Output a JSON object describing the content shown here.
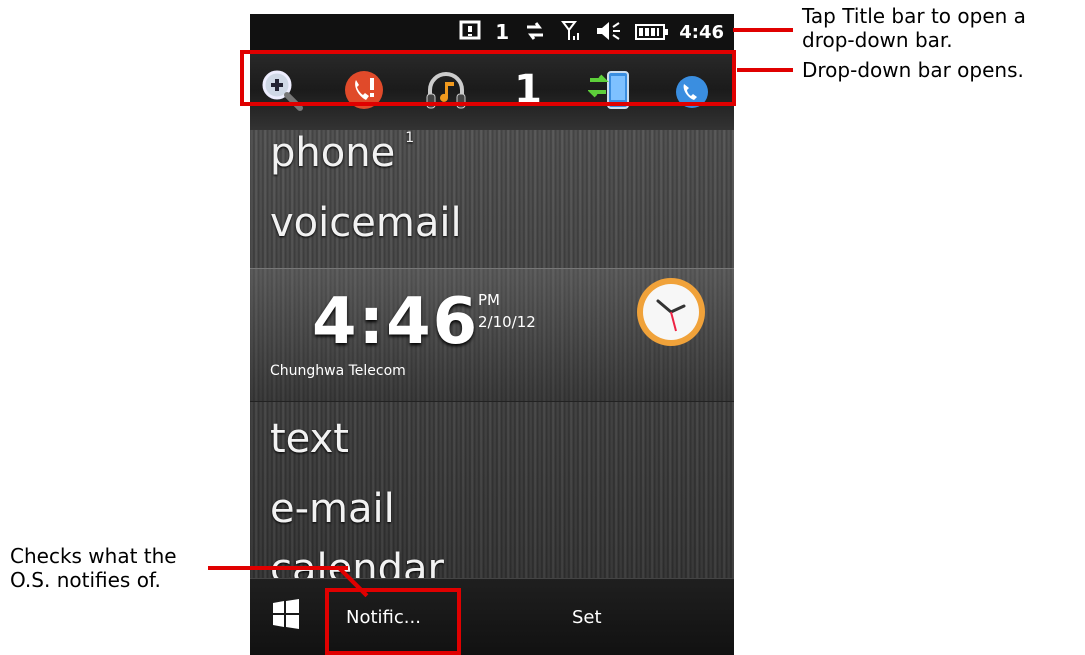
{
  "status_bar": {
    "notification_count": "1",
    "time": "4:46",
    "icons": [
      "notification-icon",
      "data-arrows-icon",
      "signal-icon",
      "speaker-muted-icon",
      "battery-icon"
    ]
  },
  "dropdown_bar": {
    "icons": [
      "magnifier-icon",
      "missed-call-icon",
      "headphones-music-icon",
      "number-one-icon",
      "device-sync-icon",
      "phone-partial-icon"
    ],
    "number": "1"
  },
  "today": {
    "phone_label": "phone",
    "phone_count": "1",
    "voicemail_label": "voicemail",
    "time": "4:46",
    "ampm": "PM",
    "date": "2/10/12",
    "carrier": "Chunghwa Telecom",
    "text_label": "text",
    "email_label": "e-mail",
    "calendar_label": "calendar"
  },
  "softkeys": {
    "left": "Notific...",
    "right": "Set"
  },
  "annotations": {
    "title_bar_note_line1": "Tap Title bar to open a",
    "title_bar_note_line2": "drop-down bar.",
    "dropdown_note": "Drop-down bar opens.",
    "notify_note_line1": "Checks what the",
    "notify_note_line2": "O.S. notifies of."
  },
  "colors": {
    "highlight": "#e00000",
    "status_bar_bg": "#111111"
  }
}
